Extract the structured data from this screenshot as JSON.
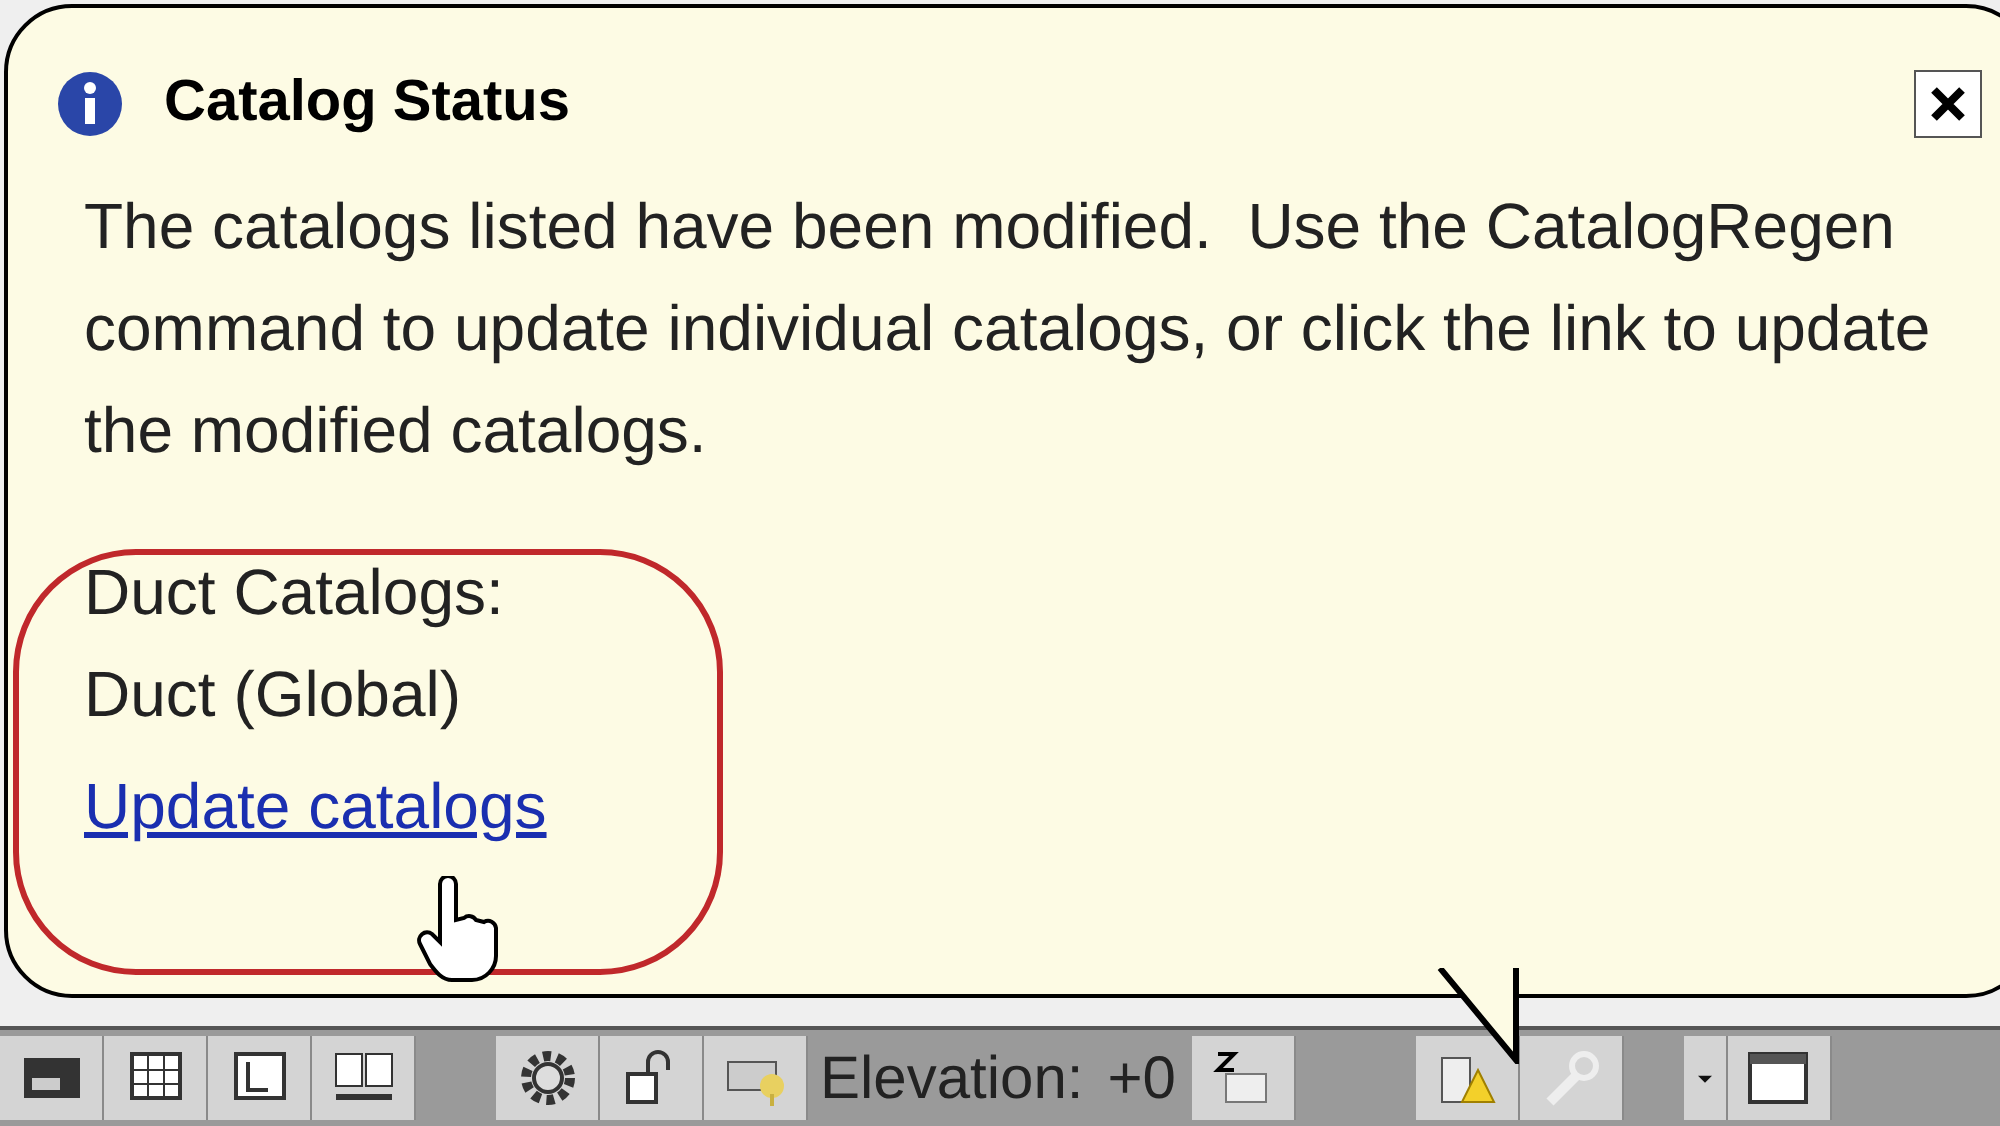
{
  "balloon": {
    "title": "Catalog Status",
    "message": "The catalogs listed have been modified.  Use the CatalogRegen command to update individual catalogs, or click the link to update the modified catalogs.",
    "catalog_group": "Duct Catalogs:",
    "catalogs": [
      "Duct (Global)"
    ],
    "link": "Update catalogs"
  },
  "status_bar": {
    "elevation_label": "Elevation:",
    "elevation_value": "+0"
  }
}
